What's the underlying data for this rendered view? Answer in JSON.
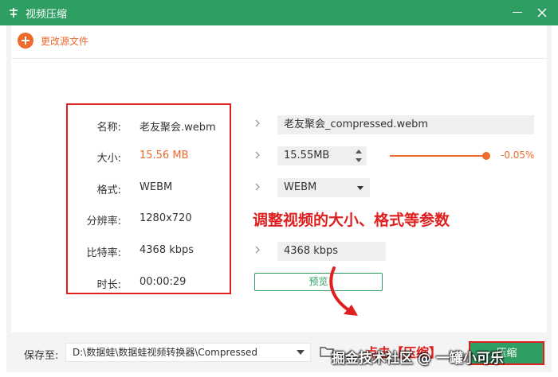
{
  "window": {
    "title": "视频压缩",
    "app_icon": "scissors-icon"
  },
  "toolbar": {
    "change_source_label": "更改源文件"
  },
  "source": {
    "name_label": "名称:",
    "name_value": "老友聚会.webm",
    "size_label": "大小:",
    "size_value": "15.56 MB",
    "format_label": "格式:",
    "format_value": "WEBM",
    "resolution_label": "分辨率:",
    "resolution_value": "1280x720",
    "bitrate_label": "比特率:",
    "bitrate_value": "4368 kbps",
    "duration_label": "时长:",
    "duration_value": "00:00:29"
  },
  "output": {
    "name_value": "老友聚会_compressed.webm",
    "size_value": "15.55MB",
    "compression_percent": "-0.05%",
    "slider_level": 0.95,
    "format_value": "WEBM",
    "bitrate_value": "4368 kbps",
    "preview_label": "预览"
  },
  "annotations": {
    "adjust_params": "调整视频的大小、格式等参数",
    "click_compress": "点击【压缩】"
  },
  "footer": {
    "save_to_label": "保存至:",
    "save_path": "D:\\数据蛙\\数据蛙视频转换器\\Compressed",
    "compress_label": "压缩"
  },
  "watermark": "掘金技术社区 @ 一罐小可乐",
  "colors": {
    "brand_green": "#2e9e63",
    "accent_orange": "#ee6a2e",
    "annotation_red": "#e02020"
  }
}
